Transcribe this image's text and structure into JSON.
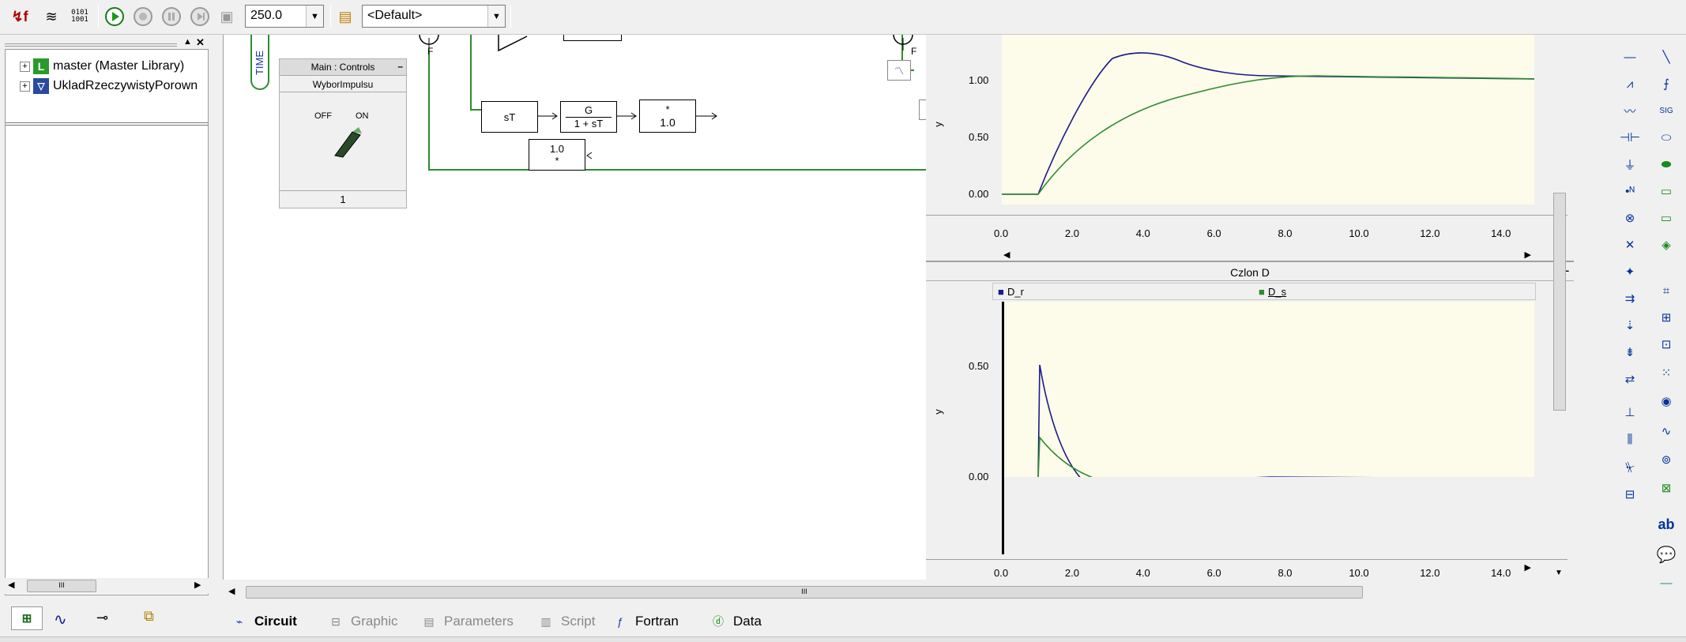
{
  "toolbar": {
    "runtime_value": "250.0",
    "project_select": "<Default>"
  },
  "tree": {
    "items": [
      {
        "label": "master (Master Library)",
        "icon_letter": "L"
      },
      {
        "label": "UkladRzeczywistyPorown"
      }
    ],
    "scroll_grip": "III"
  },
  "controls_panel": {
    "header": "Main : Controls",
    "name": "WyborImpulsu",
    "off_label": "OFF",
    "on_label": "ON",
    "value": "1"
  },
  "circuit": {
    "time_label": "TIME",
    "f_label_1": "F",
    "f_label_2": "F",
    "block_st": "sT",
    "block_g_num": "G",
    "block_g_den": "1 + sT",
    "block_mul_top": "*",
    "block_mul_bot": "1.0",
    "block_gain_top": "1.0",
    "block_gain_bot": "*"
  },
  "graph_top": {
    "y_label": "y",
    "y_ticks": [
      "1.00",
      "0.50",
      "0.00"
    ],
    "x_ticks": [
      "0.0",
      "2.0",
      "4.0",
      "6.0",
      "8.0",
      "10.0",
      "12.0",
      "14.0"
    ]
  },
  "graph_bottom": {
    "title": "Czlon D",
    "legend": [
      "D_r",
      "D_s"
    ],
    "y_label": "y",
    "y_ticks": [
      "0.50",
      "0.00"
    ],
    "x_ticks": [
      "0.0",
      "2.0",
      "4.0",
      "6.0",
      "8.0",
      "10.0",
      "12.0",
      "14.0"
    ]
  },
  "scrollbar": {
    "grip": "III"
  },
  "tabs": [
    {
      "label": "Circuit",
      "active": true
    },
    {
      "label": "Graphic",
      "active": false
    },
    {
      "label": "Parameters",
      "active": false
    },
    {
      "label": "Script",
      "active": false
    },
    {
      "label": "Fortran",
      "active": true
    },
    {
      "label": "Data",
      "active": true
    }
  ],
  "palette": {
    "text_tool": "ab"
  },
  "colors": {
    "series_1": "#1a1a8c",
    "series_2": "#2e8b2e",
    "plot_bg": "#fdfbea"
  }
}
